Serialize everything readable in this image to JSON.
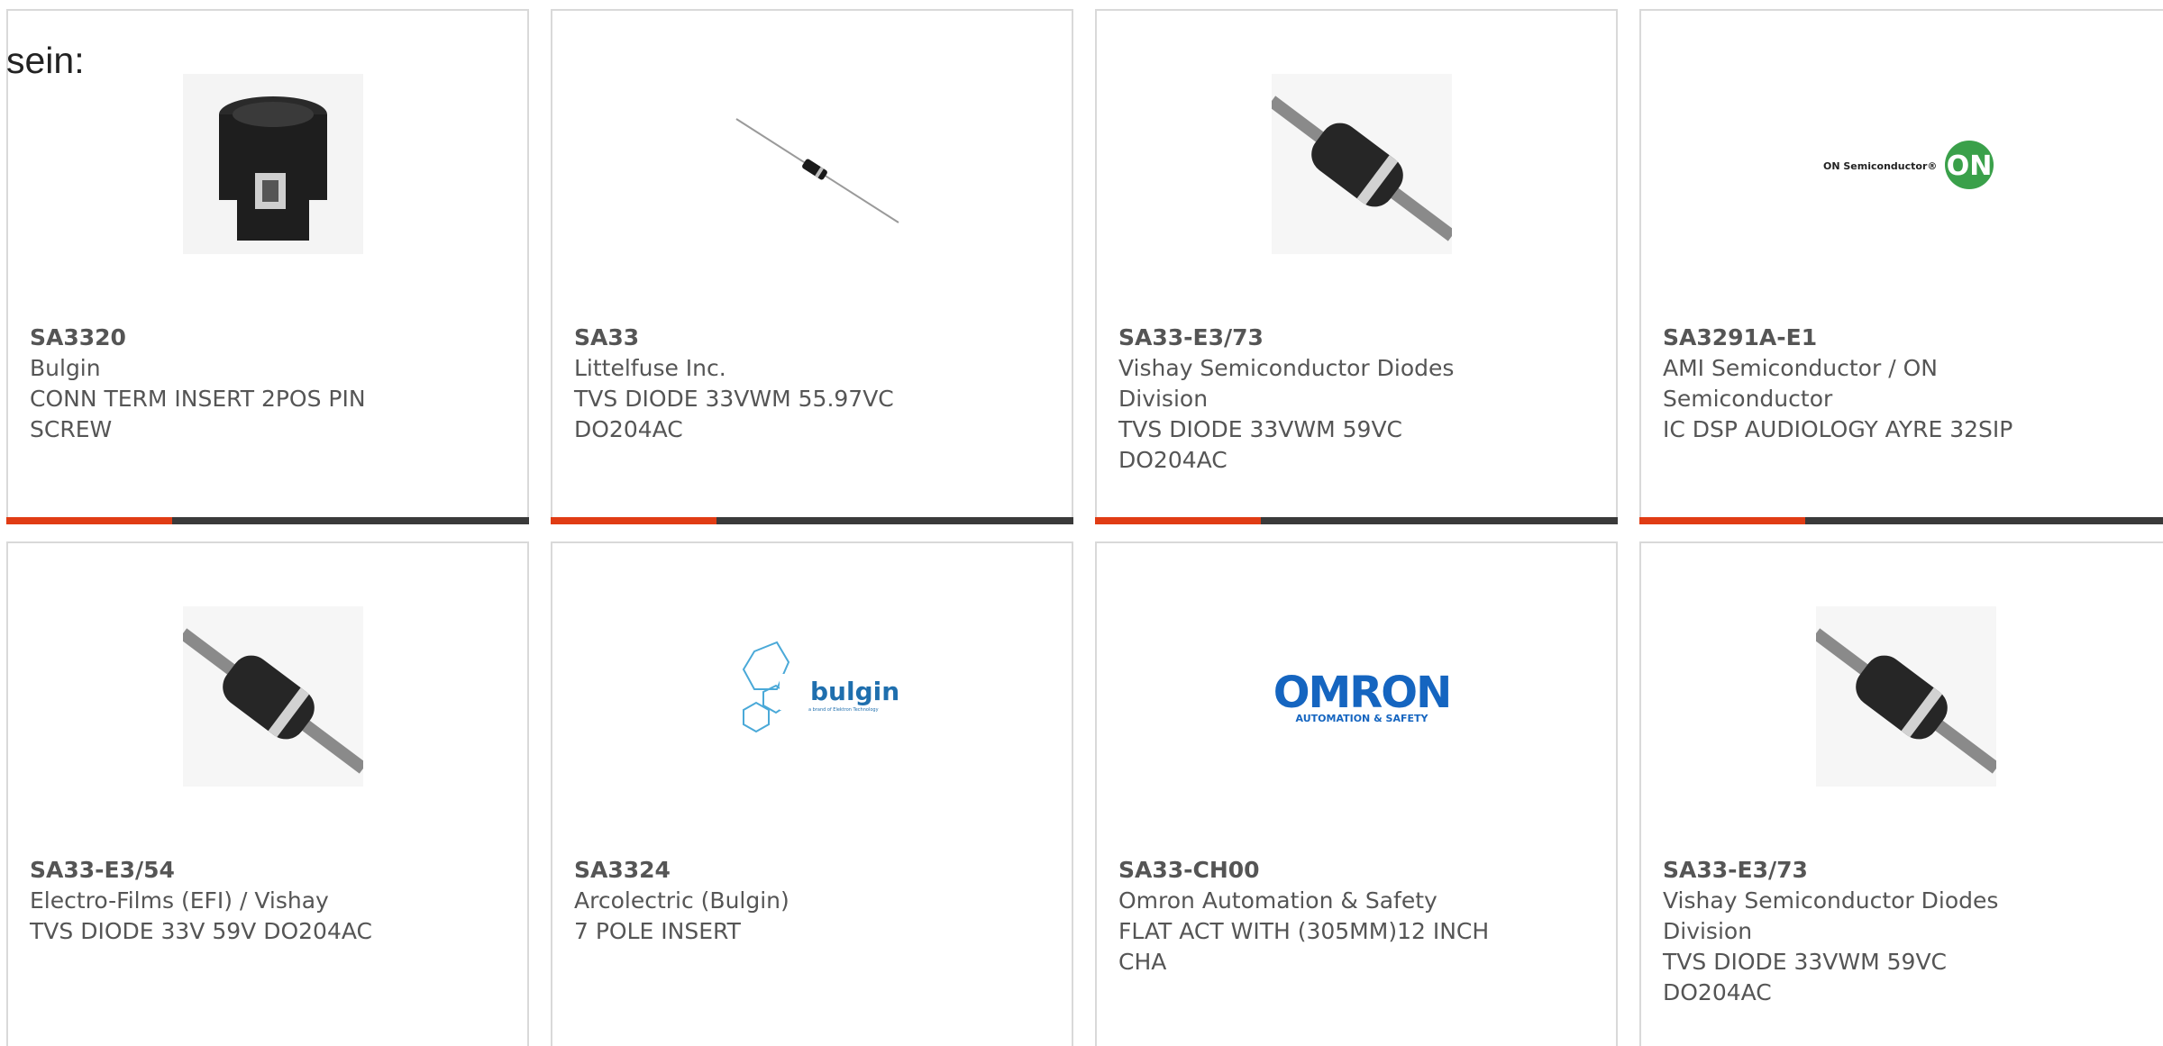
{
  "intro_text": "sein:",
  "colors": {
    "accent": "#e03c14",
    "bar": "#3a3a3a",
    "border": "#d9d9d9"
  },
  "products": [
    {
      "part": "SA3320",
      "maker": "Bulgin",
      "desc": "CONN TERM INSERT 2POS PIN SCREW",
      "image": "connector-insert-icon"
    },
    {
      "part": "SA33",
      "maker": "Littelfuse Inc.",
      "desc": "TVS DIODE 33VWM 55.97VC DO204AC",
      "image": "axial-diode-small-icon"
    },
    {
      "part": "SA33-E3/73",
      "maker": "Vishay Semiconductor Diodes Division",
      "desc": "TVS DIODE 33VWM 59VC DO204AC",
      "image": "axial-diode-icon"
    },
    {
      "part": "SA3291A-E1",
      "maker": "AMI Semiconductor / ON Semiconductor",
      "desc": "IC DSP AUDIOLOGY AYRE 32SIP",
      "image": "on-semiconductor-logo",
      "logo_text": "ON Semiconductor®",
      "logo_badge": "ON"
    },
    {
      "part": "SA33-E3/54",
      "maker": "Electro-Films (EFI) / Vishay",
      "desc": "TVS DIODE 33V 59V DO204AC",
      "image": "axial-diode-icon"
    },
    {
      "part": "SA3324",
      "maker": "Arcolectric (Bulgin)",
      "desc": "7 POLE INSERT",
      "image": "bulgin-logo",
      "logo_text": "bulgin",
      "logo_sub": "a brand of Elektron Technology"
    },
    {
      "part": "SA33-CH00",
      "maker": "Omron Automation & Safety",
      "desc": "FLAT ACT WITH (305MM)12 INCH CHA",
      "image": "omron-logo",
      "logo_text": "OMRON",
      "logo_sub": "AUTOMATION & SAFETY"
    },
    {
      "part": "SA33-E3/73",
      "maker": "Vishay Semiconductor Diodes Division",
      "desc": "TVS DIODE 33VWM 59VC DO204AC",
      "image": "axial-diode-icon"
    }
  ]
}
